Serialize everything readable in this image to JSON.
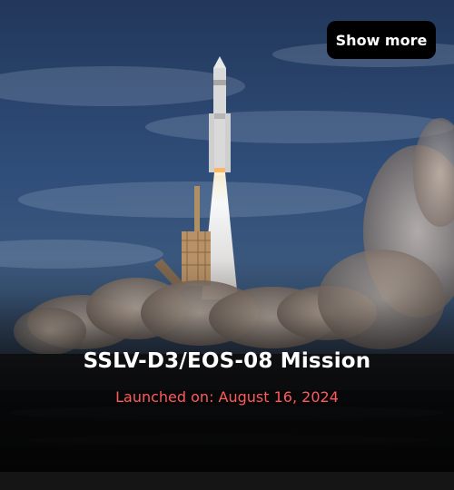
{
  "card": {
    "image_alt": "Rocket launch",
    "button_label": "Show more",
    "mission_title": "SSLV-D3/EOS-08 Mission",
    "launch_text": "Launched on: August 16, 2024"
  },
  "colors": {
    "accent": "#ff5a5a",
    "button_bg": "#000000",
    "title": "#ffffff"
  }
}
